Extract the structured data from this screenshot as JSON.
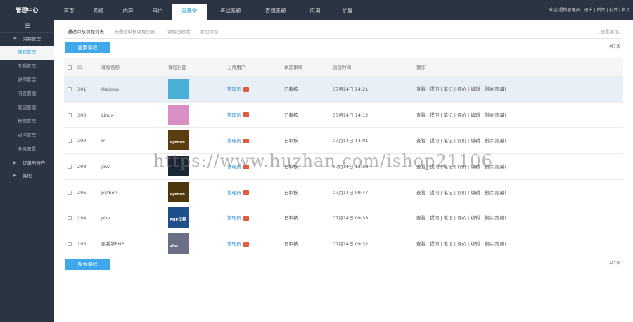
{
  "header": {
    "brand": "管理中心",
    "nav": [
      "首页",
      "系统",
      "内容",
      "用户",
      "云课堂",
      "考试系统",
      "直播系统",
      "应用",
      "扩展"
    ],
    "active_nav": "云课堂",
    "links": "欢迎 超级管理员 | 退出 | 后台 | 前台 | 首页"
  },
  "sidebar": {
    "toggle": "☰",
    "groups": [
      {
        "label": "内容管理",
        "items": [
          "课程管理",
          "专辑管理",
          "讲师管理",
          "问答管理",
          "笔记管理",
          "标签管理",
          "点评管理",
          "分类配置"
        ]
      },
      {
        "label": "订单与账户",
        "items": []
      },
      {
        "label": "其他",
        "items": []
      }
    ],
    "active_item": "课程管理"
  },
  "main": {
    "tabs": [
      "通过审核课程列表",
      "未通过审核课程列表",
      "课程回收站",
      "添加课程"
    ],
    "active_tab": "通过审核课程列表",
    "page_note": "[配置课程]",
    "button_label": "搜索课程",
    "count_label": "共7条",
    "columns": {
      "id": "ID",
      "name": "课程名称",
      "cover": "课程封面",
      "user": "上传用户",
      "status": "状态审核",
      "time": "创建时间",
      "ops": "操作"
    },
    "rows": [
      {
        "id": "301",
        "name": "Hadoop",
        "cover_text": "",
        "cover_color": "#4bb0d8",
        "user": "管理员",
        "status": "已审核",
        "time": "07月14日 14:21",
        "ops": "查看 | 提问 | 笔记 | 评价 | 编辑 | 删除(隐藏)"
      },
      {
        "id": "300",
        "name": "Linux",
        "cover_text": "",
        "cover_color": "#d98fc4",
        "user": "管理员",
        "status": "已审核",
        "time": "07月14日 14:12",
        "ops": "查看 | 提问 | 笔记 | 评价 | 编辑 | 删除(隐藏)"
      },
      {
        "id": "299",
        "name": "m",
        "cover_text": "Python",
        "cover_color": "#5a3c0e",
        "user": "管理员",
        "status": "已审核",
        "time": "07月14日 14:01",
        "ops": "查看 | 提问 | 笔记 | 评价 | 编辑 | 删除(隐藏)"
      },
      {
        "id": "298",
        "name": "java",
        "cover_text": "",
        "cover_color": "#1a2635",
        "user": "管理员",
        "status": "已审核",
        "time": "07月14日 13:58",
        "ops": "查看 | 提问 | 笔记 | 评价 | 编辑 | 删除(隐藏)"
      },
      {
        "id": "296",
        "name": "python",
        "cover_text": "Python",
        "cover_color": "#4e370c",
        "user": "管理员",
        "status": "已审核",
        "time": "07月14日 09:47",
        "ops": "查看 | 提问 | 笔记 | 评价 | 编辑 | 删除(隐藏)"
      },
      {
        "id": "294",
        "name": "php",
        "cover_text": "PHP工程",
        "cover_color": "#1e4f8a",
        "user": "管理员",
        "status": "已审核",
        "time": "07月14日 09:38",
        "ops": "查看 | 提问 | 笔记 | 评价 | 编辑 | 删除(隐藏)"
      },
      {
        "id": "293",
        "name": "跟我学PHP",
        "cover_text": "php",
        "cover_color": "#6a6f86",
        "user": "管理员",
        "status": "已审核",
        "time": "07月14日 09:32",
        "ops": "查看 | 提问 | 笔记 | 评价 | 编辑 | 删除(隐藏)"
      }
    ]
  },
  "watermark": "https://www.huzhan.com/ishop21106"
}
